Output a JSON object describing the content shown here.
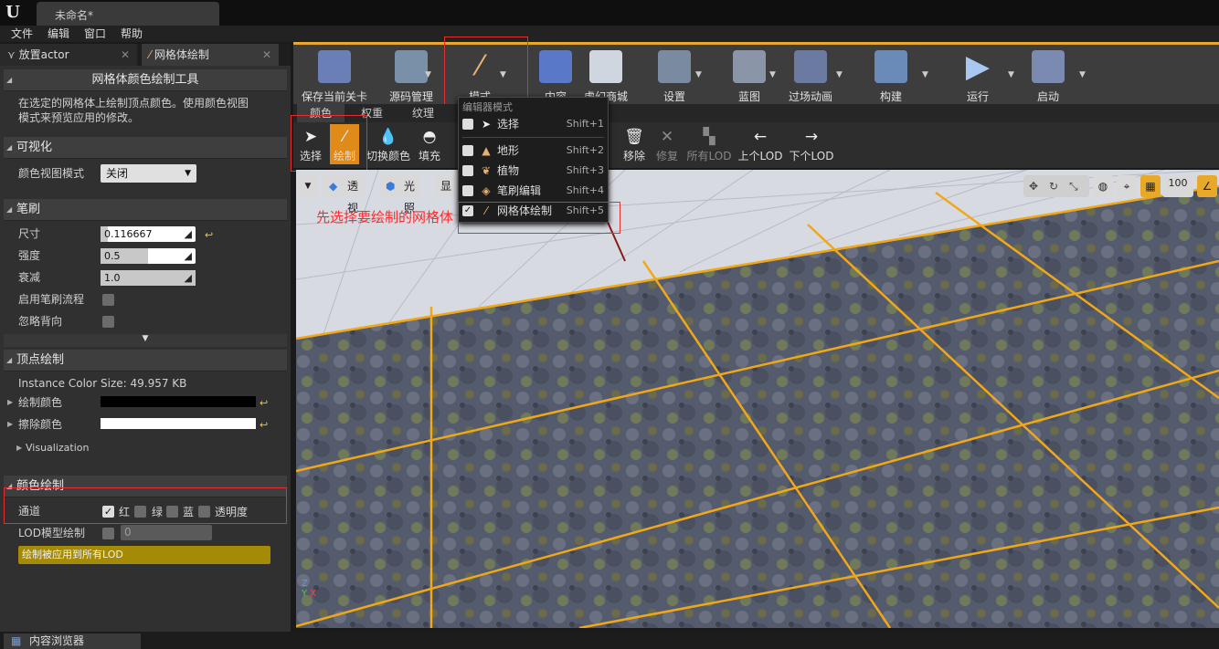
{
  "window": {
    "doc_tab": "未命名*"
  },
  "menu": [
    "文件",
    "编辑",
    "窗口",
    "帮助"
  ],
  "left_tabs": {
    "place": "放置actor",
    "mesh_paint": "网格体绘制"
  },
  "panel": {
    "header": "网格体颜色绘制工具",
    "desc_line1": "在选定的网格体上绘制顶点颜色。使用颜色视图",
    "desc_line2": "模式来预览应用的修改。",
    "visualization": {
      "title": "可视化",
      "color_view_label": "颜色视图模式",
      "color_view_value": "关闭"
    },
    "brush": {
      "title": "笔刷",
      "size_label": "尺寸",
      "size_value": "0.116667",
      "strength_label": "强度",
      "strength_value": "0.5",
      "falloff_label": "衰减",
      "falloff_value": "1.0",
      "flow_label": "启用笔刷流程",
      "backface_label": "忽略背向"
    },
    "vertex": {
      "title": "顶点绘制",
      "instance_size": "Instance Color Size: 49.957 KB",
      "paint_color": "绘制颜色",
      "erase_color": "擦除颜色",
      "visualization": "Visualization"
    },
    "color": {
      "title": "颜色绘制",
      "channel_label": "通道",
      "red": "红",
      "green": "绿",
      "blue": "蓝",
      "alpha": "透明度",
      "lod_label": "LOD模型绘制",
      "lod_value": "0",
      "apply_all": "绘制被应用到所有LOD"
    }
  },
  "toolbar": {
    "save": "保存当前关卡",
    "source": "源码管理",
    "modes": "模式",
    "content": "内容",
    "market": "虚幻商城",
    "settings": "设置",
    "blueprint": "蓝图",
    "cinematics": "过场动画",
    "build": "构建",
    "play": "运行",
    "launch": "启动"
  },
  "mode_tabs": {
    "color": "颜色",
    "weight": "权重",
    "texture": "纹理"
  },
  "toolbar2": {
    "select": "选择",
    "paint": "绘制",
    "swap": "切换颜色",
    "fill": "填充",
    "remove": "移除",
    "fix": "修复",
    "all_lod": "所有LOD",
    "prev_lod": "上个LOD",
    "next_lod": "下个LOD"
  },
  "viewport": {
    "perspective": "透视",
    "lit": "光照",
    "show": "显示",
    "grid_size": "100"
  },
  "annotation": "先选择要绘制的网格体",
  "dropdown": {
    "header": "编辑器模式",
    "items": [
      {
        "label": "选择",
        "shortcut": "Shift+1",
        "checked": false
      },
      {
        "label": "地形",
        "shortcut": "Shift+2",
        "checked": false
      },
      {
        "label": "植物",
        "shortcut": "Shift+3",
        "checked": false
      },
      {
        "label": "笔刷编辑",
        "shortcut": "Shift+4",
        "checked": false
      },
      {
        "label": "网格体绘制",
        "shortcut": "Shift+5",
        "checked": true
      }
    ]
  },
  "bottom": {
    "content_browser": "内容浏览器"
  },
  "colors": {
    "accent": "#e8a82a",
    "annotation": "#ff2a2a",
    "lod_bar": "#a58a05"
  }
}
